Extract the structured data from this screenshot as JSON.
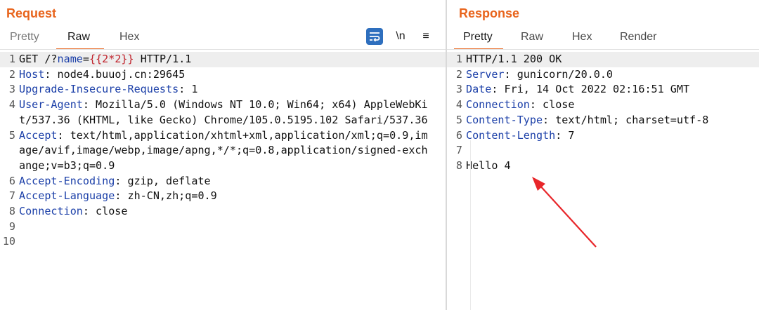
{
  "request": {
    "title": "Request",
    "tabs": [
      "Pretty",
      "Raw",
      "Hex"
    ],
    "active_tab": "Raw",
    "tools": {
      "wrap_icon": "wrap-lines-icon",
      "newline": "\\n",
      "menu": "≡"
    },
    "lines": [
      {
        "num": "1",
        "parts": [
          {
            "t": "GET /?",
            "c": ""
          },
          {
            "t": "name",
            "c": "pn"
          },
          {
            "t": "=",
            "c": ""
          },
          {
            "t": "{{2*2}}",
            "c": "pv"
          },
          {
            "t": " HTTP/1.1",
            "c": ""
          }
        ],
        "highlight": true
      },
      {
        "num": "2",
        "parts": [
          {
            "t": "Host",
            "c": "hn"
          },
          {
            "t": ": node4.buuoj.cn:29645",
            "c": ""
          }
        ]
      },
      {
        "num": "3",
        "parts": [
          {
            "t": "Upgrade-Insecure-Requests",
            "c": "hn"
          },
          {
            "t": ": 1",
            "c": ""
          }
        ]
      },
      {
        "num": "4",
        "parts": [
          {
            "t": "User-Agent",
            "c": "hn"
          },
          {
            "t": ": Mozilla/5.0 (Windows NT 10.0; Win64; x64) AppleWebKit/537.36 (KHTML, like Gecko) Chrome/105.0.5195.102 Safari/537.36",
            "c": ""
          }
        ]
      },
      {
        "num": "5",
        "parts": [
          {
            "t": "Accept",
            "c": "hn"
          },
          {
            "t": ": text/html,application/xhtml+xml,application/xml;q=0.9,image/avif,image/webp,image/apng,*/*;q=0.8,application/signed-exchange;v=b3;q=0.9",
            "c": ""
          }
        ]
      },
      {
        "num": "6",
        "parts": [
          {
            "t": "Accept-Encoding",
            "c": "hn"
          },
          {
            "t": ": gzip, deflate",
            "c": ""
          }
        ]
      },
      {
        "num": "7",
        "parts": [
          {
            "t": "Accept-Language",
            "c": "hn"
          },
          {
            "t": ": zh-CN,zh;q=0.9",
            "c": ""
          }
        ]
      },
      {
        "num": "8",
        "parts": [
          {
            "t": "Connection",
            "c": "hn"
          },
          {
            "t": ": close",
            "c": ""
          }
        ]
      },
      {
        "num": "9",
        "parts": []
      },
      {
        "num": "10",
        "parts": []
      }
    ]
  },
  "response": {
    "title": "Response",
    "tabs": [
      "Pretty",
      "Raw",
      "Hex",
      "Render"
    ],
    "active_tab": "Pretty",
    "lines": [
      {
        "num": "1",
        "parts": [
          {
            "t": "HTTP/1.1 200 OK",
            "c": ""
          }
        ],
        "highlight": true
      },
      {
        "num": "2",
        "parts": [
          {
            "t": "Server",
            "c": "hn"
          },
          {
            "t": ": gunicorn/20.0.0",
            "c": ""
          }
        ]
      },
      {
        "num": "3",
        "parts": [
          {
            "t": "Date",
            "c": "hn"
          },
          {
            "t": ": Fri, 14 Oct 2022 02:16:51 GMT",
            "c": ""
          }
        ]
      },
      {
        "num": "4",
        "parts": [
          {
            "t": "Connection",
            "c": "hn"
          },
          {
            "t": ": close",
            "c": ""
          }
        ]
      },
      {
        "num": "5",
        "parts": [
          {
            "t": "Content-Type",
            "c": "hn"
          },
          {
            "t": ": text/html; charset=utf-8",
            "c": ""
          }
        ]
      },
      {
        "num": "6",
        "parts": [
          {
            "t": "Content-Length",
            "c": "hn"
          },
          {
            "t": ": 7",
            "c": ""
          }
        ]
      },
      {
        "num": "7",
        "parts": []
      },
      {
        "num": "8",
        "parts": [
          {
            "t": "Hello 4",
            "c": ""
          }
        ]
      }
    ]
  },
  "colors": {
    "accent": "#e8641c",
    "header_name": "#1b3fa8",
    "param_value": "#c0232c",
    "arrow": "#e8262a",
    "wrap_button": "#2e6fbe"
  }
}
